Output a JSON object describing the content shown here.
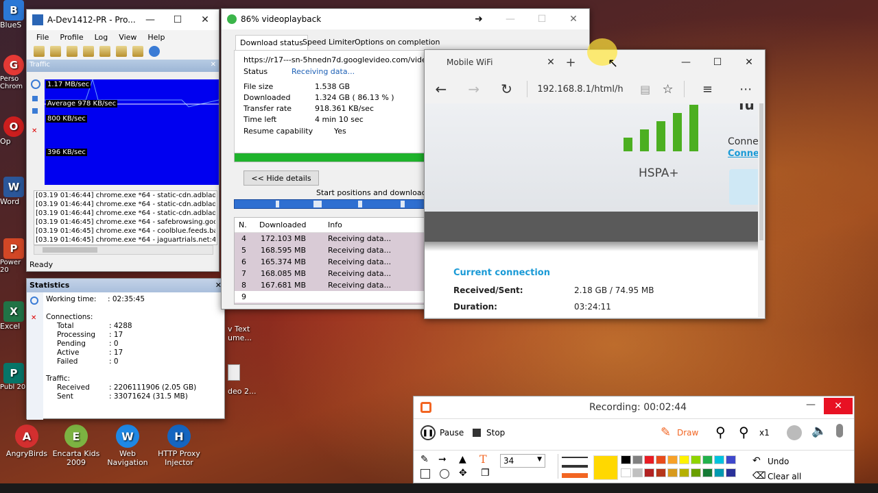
{
  "desktop": {
    "left_icons": [
      {
        "label": "BlueS",
        "color": "#2b78d6",
        "glyph": "B"
      },
      {
        "label": "Perso Chrom",
        "color": "#e53935",
        "glyph": "G"
      },
      {
        "label": "Op",
        "color": "#cc1e1e",
        "glyph": "O"
      },
      {
        "label": "Word",
        "color": "#2b579a",
        "glyph": "W"
      },
      {
        "label": "Power 20",
        "color": "#d24726",
        "glyph": "P"
      },
      {
        "label": "Excel",
        "color": "#217346",
        "glyph": "X"
      },
      {
        "label": "Publ 20",
        "color": "#077568",
        "glyph": "P"
      }
    ],
    "bottom_icons": [
      {
        "label": "AngryBirds",
        "color": "#d32f2f",
        "glyph": "A"
      },
      {
        "label": "Encarta Kids 2009",
        "color": "#7cb342",
        "glyph": "E"
      },
      {
        "label": "Web Navigation",
        "color": "#1e88e5",
        "glyph": "W"
      },
      {
        "label": "HTTP Proxy Injector",
        "color": "#1565c0",
        "glyph": "H"
      }
    ],
    "partial_icons": [
      {
        "label": "v Text ume..."
      },
      {
        "label": "deo 2..."
      }
    ]
  },
  "netlimiter": {
    "title": "A-Dev1412-PR - Pro...",
    "menu": [
      "File",
      "Profile",
      "Log",
      "View",
      "Help"
    ],
    "traffic_panel_title": "Traffic",
    "graph_labels": [
      "1.17 MB/sec",
      "Average 978 KB/sec",
      "800 KB/sec",
      "396 KB/sec"
    ],
    "log": [
      "[03.19 01:46:44] chrome.exe *64 - static-cdn.adblade.",
      "[03.19 01:46:44] chrome.exe *64 - static-cdn.adblade.",
      "[03.19 01:46:44] chrome.exe *64 - static-cdn.adblade.",
      "[03.19 01:46:45] chrome.exe *64 - safebrowsing.goog",
      "[03.19 01:46:45] chrome.exe *64 - coolblue.feeds.ban",
      "[03.19 01:46:45] chrome.exe *64 - jaguartrials.net:443"
    ],
    "status": "Ready"
  },
  "statistics": {
    "title": "Statistics",
    "working_time_label": "Working time:",
    "working_time": ": 02:35:45",
    "connections_label": "Connections:",
    "rows": [
      {
        "label": "Total",
        "value": ": 4288"
      },
      {
        "label": "Processing",
        "value": ": 17"
      },
      {
        "label": "Pending",
        "value": ": 0"
      },
      {
        "label": "Active",
        "value": ": 17"
      },
      {
        "label": "Failed",
        "value": ": 0"
      }
    ],
    "traffic_label": "Traffic:",
    "received_label": "Received",
    "received_value": ": 2206111906   (2.05 GB)",
    "sent_label": "Sent",
    "sent_value": ": 33071624   (31.5 MB)"
  },
  "idm": {
    "title": "86% videoplayback",
    "tabs": [
      "Download status",
      "Speed Limiter",
      "Options on completion"
    ],
    "url": "https://r17---sn-5hnedn7d.googlevideo.com/videoplayb",
    "status_label": "Status",
    "status_value": "Receiving data...",
    "fields": [
      {
        "label": "File size",
        "value": "1.538  GB"
      },
      {
        "label": "Downloaded",
        "value": "1.324  GB  ( 86.13 % )"
      },
      {
        "label": "Transfer rate",
        "value": "918.361  KB/sec"
      },
      {
        "label": "Time left",
        "value": "4 min  10 sec"
      },
      {
        "label": "Resume capability",
        "value": "Yes"
      }
    ],
    "progress": 0.8613,
    "hide_details": "<< Hide details",
    "segments_caption": "Start positions and download pro",
    "table_headers": [
      "N.",
      "Downloaded",
      "Info"
    ],
    "rows": [
      {
        "n": "4",
        "dl": "172.103  MB",
        "info": "Receiving data..."
      },
      {
        "n": "5",
        "dl": "168.595  MB",
        "info": "Receiving data..."
      },
      {
        "n": "6",
        "dl": "165.374  MB",
        "info": "Receiving data..."
      },
      {
        "n": "7",
        "dl": "168.085  MB",
        "info": "Receiving data..."
      },
      {
        "n": "8",
        "dl": "167.681  MB",
        "info": "Receiving data..."
      },
      {
        "n": "9",
        "dl": "",
        "info": ""
      }
    ]
  },
  "edge": {
    "tab_title": "Mobile WiFi",
    "address": "192.168.8.1/html/h",
    "network_type": "HSPA+",
    "conn_label_1": "Conne",
    "conn_label_2": "Conne",
    "partial_heading": "Tu",
    "section_title": "Current connection",
    "received_sent_label": "Received/Sent:",
    "received_sent_value": "2.18 GB /  74.95 MB",
    "duration_label": "Duration:",
    "duration_value": "03:24:11",
    "signal_bars": 5
  },
  "recorder": {
    "title": "Recording:  00:02:44",
    "pause": "Pause",
    "stop": "Stop",
    "draw": "Draw",
    "zoom": "x1",
    "font_size": "34",
    "undo": "Undo",
    "clear_all": "Clear all",
    "accent": "#f26522",
    "palette_top": [
      "#000000",
      "#808080",
      "#e81c24",
      "#e84b1c",
      "#f7a128",
      "#fff200",
      "#8fd400",
      "#22b14c",
      "#00c2de",
      "#3f48cc"
    ],
    "palette_bottom": [
      "#ffffff",
      "#c0c0c0",
      "#b22222",
      "#b5361a",
      "#d79a1d",
      "#b5b000",
      "#6a9f00",
      "#157a35",
      "#0099b0",
      "#2a3199"
    ],
    "selected_color": "#ffd800"
  }
}
